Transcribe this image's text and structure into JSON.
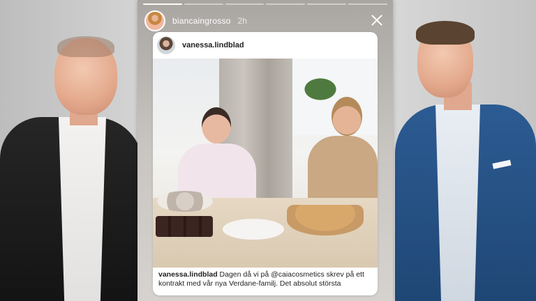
{
  "story": {
    "username": "biancaingrosso",
    "time": "2h",
    "progress_segments": 6,
    "active_segment": 0
  },
  "post": {
    "username": "vanessa.lindblad",
    "caption_user": "vanessa.lindblad",
    "caption_text": "Dagen då vi på @caiacosmetics skrev på ett kontrakt med vår nya Verdane-familj. Det absolut största"
  },
  "icons": {
    "close": "close-icon",
    "story_avatar": "avatar",
    "post_avatar": "avatar"
  },
  "colors": {
    "right_jacket": "#2c5b93",
    "left_jacket": "#1a1a1a",
    "card_bg": "#ffffff"
  }
}
